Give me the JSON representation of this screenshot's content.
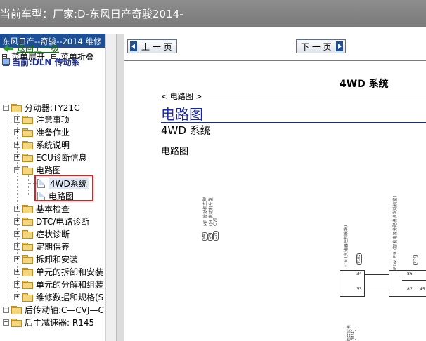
{
  "window": {
    "title": "当前车型：厂家:D-东风日产奇骏2014-"
  },
  "sidebar": {
    "header": "东风日产--奇骏--2014 维修",
    "expand_label": "菜单展开",
    "collapse_label": "菜单折叠",
    "back_label": "返回上一级",
    "current_label": "当前:DLN 传动系",
    "tree": {
      "root": "分动器:TY21C",
      "items": [
        "注意事项",
        "准备作业",
        "系统说明",
        "ECU诊断信息",
        "电路图",
        "4WD系统",
        "电路图",
        "基本检查",
        "DTC/电路诊断",
        "症状诊断",
        "定期保养",
        "拆卸和安装",
        "单元的拆卸和安装",
        "单元的分解和组装",
        "维修数据和规格(S"
      ],
      "siblings": [
        "后传动轴:C—CVJ—C",
        "后主减速器: R145"
      ]
    }
  },
  "toolbar": {
    "prev_label": "上 一 页",
    "next_label": "下 一 页"
  },
  "document": {
    "system_title": "4WD 系统",
    "section_tag": "< 电路图 >",
    "heading": "电路图",
    "subheading": "4WD 系统",
    "subsection": "电路图",
    "diagram": {
      "labels_left": [
        "MR 发动机车型",
        "QR 发动机车型",
        "CVT"
      ],
      "tags_left": [
        "MR",
        "QR",
        "CVT"
      ],
      "tcm_label": "TCM (变速器控制模块)",
      "ecm_label": "IPDM E/R (智能电源分配模块发动机室)",
      "connector_tcm": "F102",
      "connector_ecm": "F74",
      "pins_tcm": [
        "34",
        "33"
      ],
      "pins_ecm": [
        "86",
        "87",
        "45"
      ],
      "bottom_label": "组合仪表",
      "bottom_tag": "M24"
    }
  },
  "colors": {
    "sidebar_header": "#1c4f95",
    "title_bar": "#868686",
    "heading_blue": "#1c2aa0",
    "highlight": "#e02020"
  }
}
